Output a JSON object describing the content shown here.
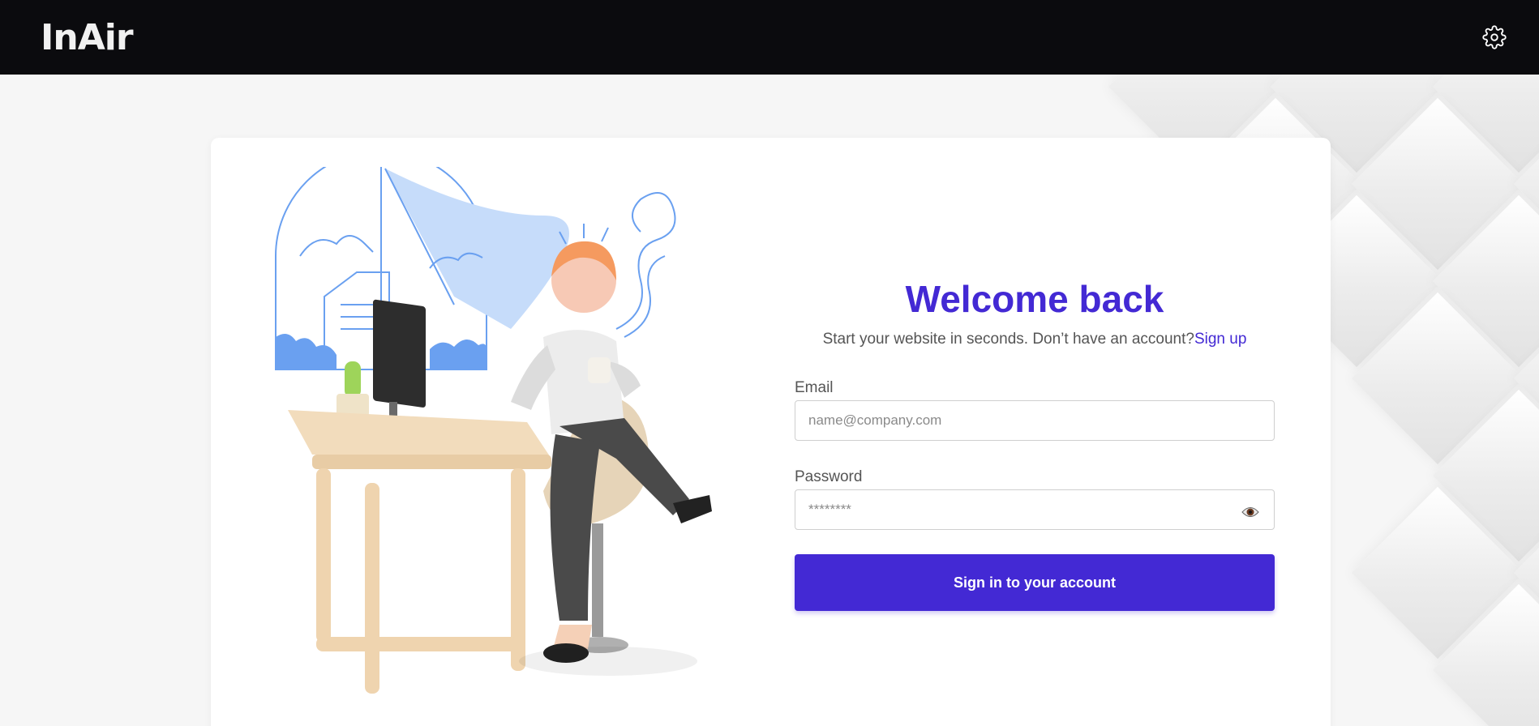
{
  "app": {
    "logo": "InAir"
  },
  "header": {
    "settings_icon": "gear-icon"
  },
  "login": {
    "title": "Welcome back",
    "subtitle": "Start your website in seconds. Don’t have an account?",
    "signup_link": "Sign up",
    "email_label": "Email",
    "email_placeholder": "name@company.com",
    "password_label": "Password",
    "password_placeholder": "********",
    "show_password_icon": "eye-icon",
    "submit_label": "Sign in to your account"
  },
  "colors": {
    "accent": "#4329d4",
    "navbar": "#0b0b0e",
    "background": "#f6f6f6"
  }
}
